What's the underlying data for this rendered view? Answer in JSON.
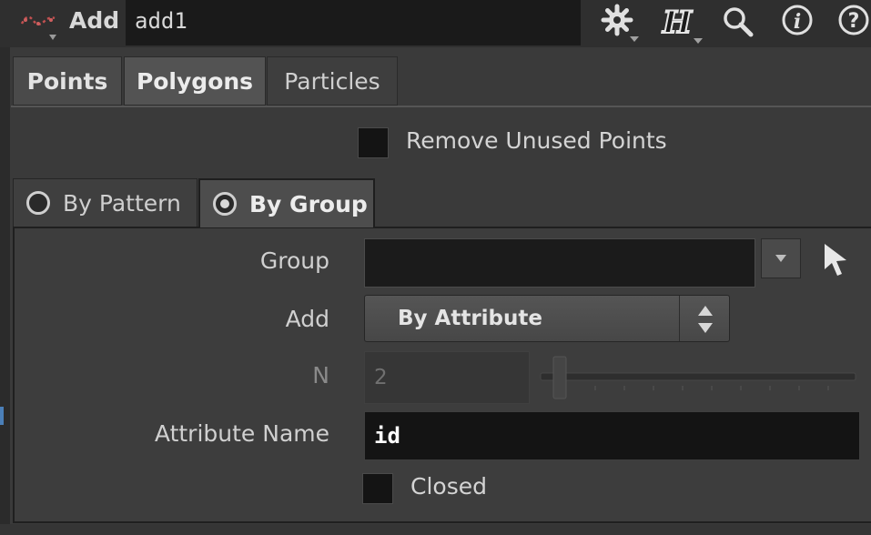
{
  "header": {
    "node_type": "Add",
    "node_name": "add1",
    "icons": [
      "node-wave-icon",
      "gear-icon",
      "houdini-h-icon",
      "search-icon",
      "info-icon",
      "help-icon"
    ]
  },
  "tabs": [
    {
      "label": "Points",
      "selected": false
    },
    {
      "label": "Polygons",
      "selected": true
    },
    {
      "label": "Particles",
      "selected": false
    }
  ],
  "remove_unused": {
    "label": "Remove Unused Points",
    "checked": false
  },
  "mode_tabs": [
    {
      "label": "By Pattern",
      "selected": false
    },
    {
      "label": "By Group",
      "selected": true
    }
  ],
  "params": {
    "group": {
      "label": "Group",
      "value": ""
    },
    "add": {
      "label": "Add",
      "value": "By Attribute"
    },
    "n": {
      "label": "N",
      "value": "2",
      "enabled": false
    },
    "attribute_name": {
      "label": "Attribute Name",
      "value": "id"
    },
    "closed": {
      "label": "Closed",
      "checked": false
    }
  },
  "colors": {
    "background": "#3a3a3a",
    "field": "#141414",
    "accent": "#4b7fb8"
  }
}
